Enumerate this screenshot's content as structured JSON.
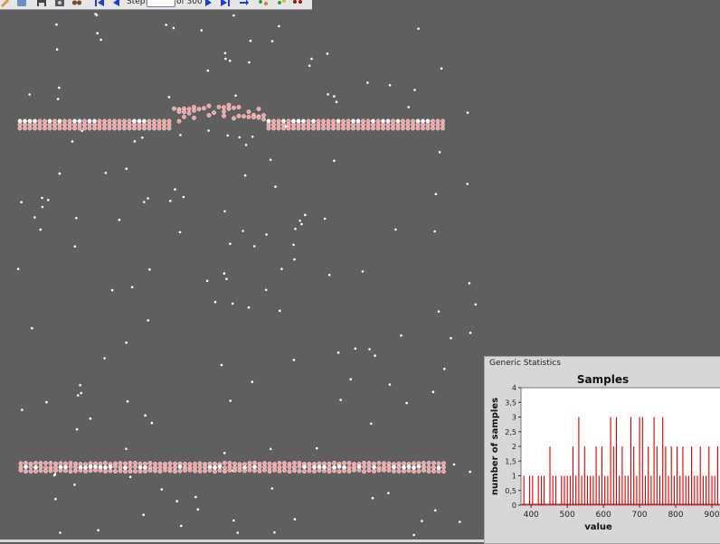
{
  "toolbar": {
    "step_label": "Step:",
    "step_value": "",
    "of_label": "of 300",
    "icons": [
      "edit-icon",
      "layout-icon",
      "save-icon",
      "camera-icon",
      "binoculars-icon",
      "rewind-icon",
      "step-back-icon",
      "step-forward-icon",
      "fast-forward-icon",
      "particles-icon",
      "particles-add-icon",
      "dots-icon"
    ]
  },
  "colors": {
    "background": "#5f5f5f",
    "particle_white": "#ffffff",
    "particle_pink": "#f4a0a0",
    "bar_red": "#e00000"
  },
  "panel": {
    "title": "Generic Statistics"
  },
  "chart_data": {
    "type": "bar",
    "title": "Samples",
    "xlabel": "value",
    "ylabel": "number of samples",
    "xlim": [
      372,
      925
    ],
    "ylim": [
      0,
      4
    ],
    "xticks": [
      400,
      500,
      600,
      700,
      800,
      900
    ],
    "yticks": [
      0,
      0.5,
      1,
      1.5,
      2,
      2.5,
      3,
      3.5,
      4
    ],
    "ytick_labels": [
      "0",
      "0,5",
      "1",
      "1,5",
      "2",
      "2,5",
      "3",
      "3,5",
      "4"
    ],
    "grid": false,
    "values_note_free": true,
    "x": [
      380,
      388,
      396,
      404,
      412,
      420,
      428,
      436,
      444,
      452,
      460,
      468,
      476,
      484,
      492,
      500,
      508,
      516,
      524,
      532,
      540,
      548,
      556,
      564,
      572,
      580,
      588,
      596,
      604,
      612,
      620,
      628,
      636,
      644,
      652,
      660,
      668,
      676,
      684,
      692,
      700,
      708,
      716,
      724,
      732,
      740,
      748,
      756,
      764,
      772,
      780,
      788,
      796,
      804,
      812,
      820,
      828,
      836,
      844,
      852,
      860,
      868,
      876,
      884,
      892,
      900,
      908,
      916,
      924
    ],
    "values": [
      1,
      0,
      1,
      1,
      0,
      1,
      1,
      1,
      0,
      2,
      1,
      1,
      0,
      1,
      1,
      1,
      1,
      2,
      1,
      3,
      1,
      2,
      1,
      1,
      1,
      2,
      1,
      2,
      1,
      1,
      3,
      2,
      3,
      1,
      2,
      1,
      1,
      3,
      2,
      1,
      3,
      3,
      1,
      2,
      1,
      3,
      2,
      1,
      3,
      2,
      1,
      2,
      1,
      2,
      1,
      2,
      1,
      1,
      2,
      1,
      1,
      2,
      1,
      1,
      2,
      1,
      1,
      2,
      1
    ]
  }
}
